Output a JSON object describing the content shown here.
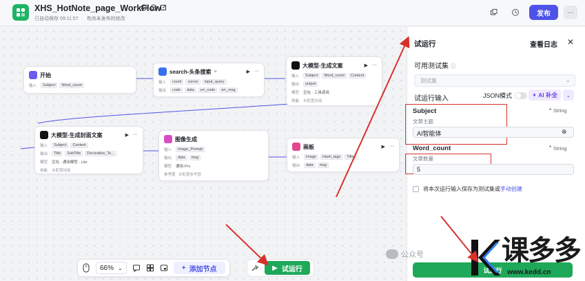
{
  "header": {
    "title": "XHS_HotNote_page_WorkFlow",
    "autosave": "已自动保存 09:11:57",
    "unpublished": "有尚未发布的修改",
    "publish_label": "发布",
    "more_label": "···"
  },
  "nodes": {
    "start": {
      "title": "开始",
      "row_in_label": "输入",
      "inputs": [
        "Subject",
        "Word_count"
      ]
    },
    "search": {
      "title": "search-头条搜索",
      "badge": "≡",
      "in_label": "输入",
      "inputs": [
        "count",
        "cursor",
        "input_query"
      ],
      "out_label": "输出",
      "outputs": [
        "code",
        "data",
        "err_code",
        "err_msg"
      ]
    },
    "llm1": {
      "title": "大模型-生成文案",
      "in_label": "输入",
      "inputs": [
        "Subject",
        "Word_count",
        "Content"
      ],
      "out_label": "输出",
      "outputs": [
        "output"
      ],
      "model_label": "模型",
      "model": "豆包 · 工具调用",
      "skill_label": "技能",
      "skill": "未配置技能"
    },
    "llm2": {
      "title": "大模型-生成封面文案",
      "in_label": "输入",
      "inputs": [
        "Subject",
        "Content"
      ],
      "out_label": "输出",
      "outputs": [
        "Title",
        "SubTitle",
        "Decorative_Te..."
      ],
      "model_label": "模型",
      "model": "豆包 · 通用模型 · Lite",
      "skill_label": "技能",
      "skill": "未配置技能"
    },
    "image": {
      "title": "图像生成",
      "in_label": "输入",
      "inputs": [
        "Image_Prompt"
      ],
      "out_label": "输出",
      "outputs": [
        "data",
        "msg"
      ],
      "model_label": "模型",
      "model": "通用-Pro",
      "ref_label": "参考图",
      "ref": "未配置参考图"
    },
    "canvas": {
      "title": "画板",
      "in_label": "输入",
      "inputs": [
        "image",
        "Hash_tags",
        "Title1"
      ],
      "out_label": "输出",
      "outputs": [
        "data",
        "msg"
      ]
    }
  },
  "bottombar": {
    "zoom": "66%",
    "add_node_label": "添加节点",
    "run_label": "试运行"
  },
  "panel": {
    "title": "试运行",
    "log_label": "查看日志",
    "close": "✕",
    "testset_label": "可用测试集",
    "testset_placeholder": "测试集",
    "run_input_label": "试运行输入",
    "json_mode_label": "JSON模式",
    "ai_label": "AI 补全",
    "fields": [
      {
        "name": "Subject",
        "required": "*",
        "type": "String",
        "desc": "文章主题",
        "value": "AI智能体"
      },
      {
        "name": "Word_count",
        "required": "*",
        "type": "String",
        "desc": "文章数量",
        "value": "5"
      }
    ],
    "save_label": "将本次运行输入保存为测试集或",
    "manual_link": "手动创建",
    "run_label": "试运行"
  },
  "watermark": {
    "wechat": "公众号",
    "brand": "课多多",
    "url": "www.kedd.cn"
  },
  "colors": {
    "accent": "#4d53e8",
    "run_green": "#1ea85a",
    "annotation_red": "#d9302b"
  }
}
